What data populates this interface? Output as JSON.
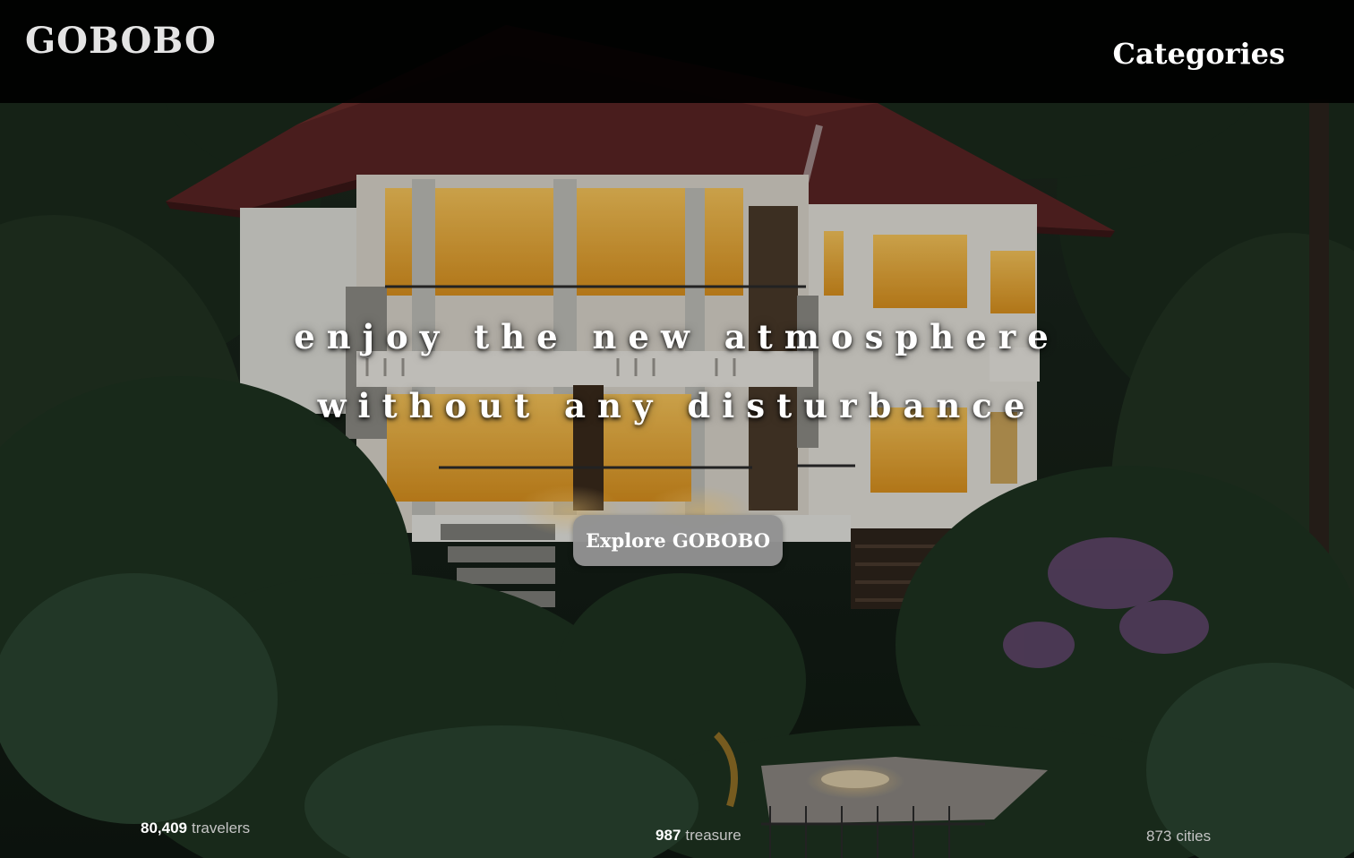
{
  "header": {
    "brand": "GOBOBO",
    "nav_categories": "Categories"
  },
  "hero": {
    "headline_line1": "enjoy the new atmosphere",
    "headline_line2": "without any disturbance",
    "cta_label": "Explore GOBOBO",
    "background_image": "villa-in-forest-at-dusk"
  },
  "stats": [
    {
      "number": "80,409",
      "label": "travelers"
    },
    {
      "number": "987",
      "label": "treasure"
    },
    {
      "number": "873",
      "label": "cities"
    }
  ],
  "colors": {
    "topbar": "#000000",
    "cta_background": "#929292",
    "text_primary": "#ffffff"
  }
}
